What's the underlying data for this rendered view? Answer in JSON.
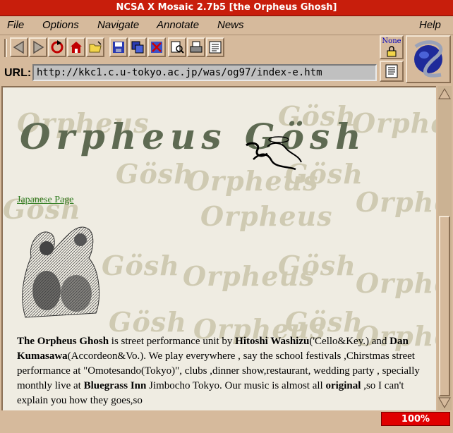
{
  "window": {
    "title": "NCSA X Mosaic 2.7b5 [the Orpheus Ghosh]"
  },
  "menu": {
    "file": "File",
    "options": "Options",
    "navigate": "Navigate",
    "annotate": "Annotate",
    "news": "News",
    "help": "Help"
  },
  "toolbar": {
    "icons": [
      "back-arrow-icon",
      "forward-arrow-icon",
      "reload-icon",
      "home-icon",
      "open-folder-icon",
      "save-disk-icon",
      "clone-window-icon",
      "close-window-icon",
      "find-icon",
      "print-icon",
      "news-icon"
    ],
    "none_label": "None"
  },
  "url": {
    "label": "URL:",
    "value": "http://kkc1.c.u-tokyo.ac.jp/was/og97/index-e.htm"
  },
  "page": {
    "watermark_a": "Orpheus",
    "watermark_b": "Gösh",
    "banner": "Orpheus  Gösh",
    "japanese_link": "Japanese Page",
    "p": {
      "t1": "The Orpheus Ghosh",
      "t2": " is street performance unit by ",
      "t3": "Hitoshi Washizu",
      "t4": "('Cello&Key.) and ",
      "t5": "Dan Kumasawa",
      "t6": "(Accordeon&Vo.). We play everywhere , say the school festivals ,Chirstmas street performance at \"Omotesando(Tokyo)\", clubs ,dinner show,restaurant, wedding party , specially monthly live at ",
      "t7": "Bluegrass Inn",
      "t8": " Jimbocho Tokyo. Our music is almost all ",
      "t9": "original",
      "t10": " ,so I can't explain you how they goes,so"
    }
  },
  "status": {
    "progress": "100%"
  },
  "colors": {
    "titlebar": "#c81e0c",
    "chrome": "#d6ba9c",
    "link": "#2e7b1e"
  }
}
